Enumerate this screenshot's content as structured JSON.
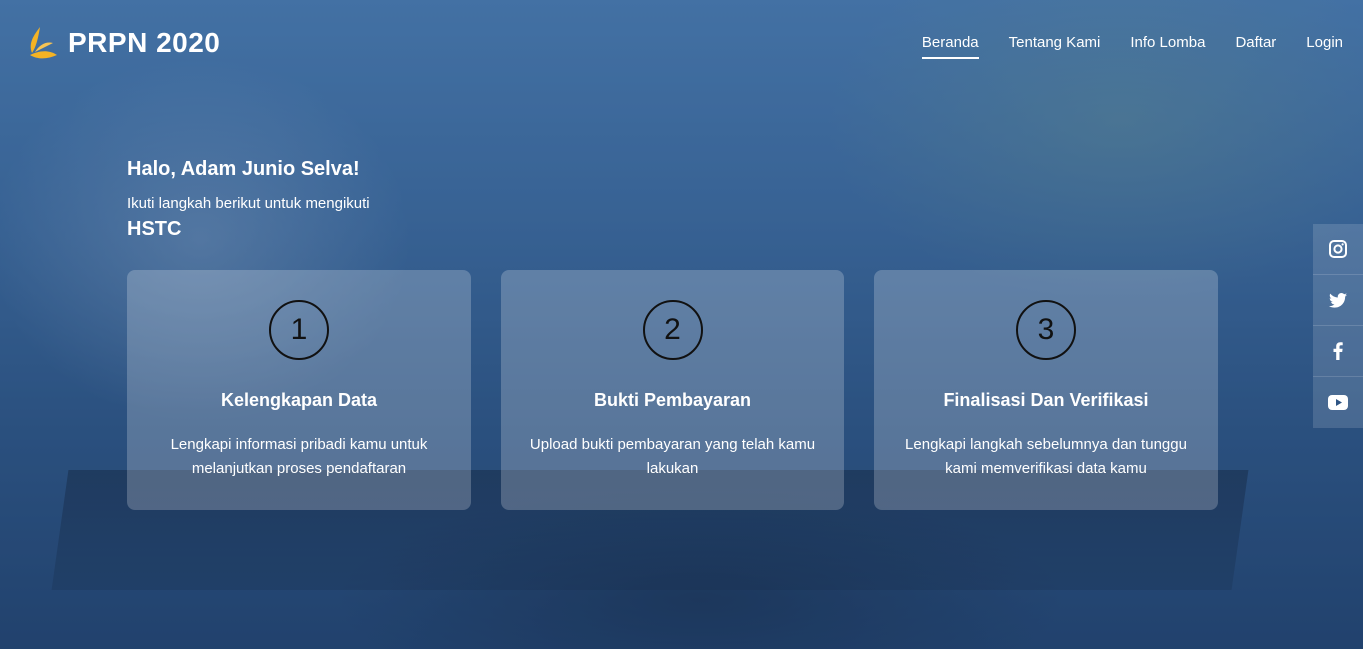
{
  "brand": {
    "name": "PRPN 2020",
    "logo_icon": "flame-leaf-icon",
    "logo_color": "#f5b324"
  },
  "nav": {
    "items": [
      {
        "label": "Beranda",
        "active": true
      },
      {
        "label": "Tentang Kami",
        "active": false
      },
      {
        "label": "Info Lomba",
        "active": false
      },
      {
        "label": "Daftar",
        "active": false
      },
      {
        "label": "Login",
        "active": false
      }
    ]
  },
  "intro": {
    "greeting": "Halo, Adam Junio Selva!",
    "subtitle": "Ikuti langkah berikut untuk mengikuti",
    "event": "HSTC"
  },
  "steps": [
    {
      "number": "1",
      "title": "Kelengkapan Data",
      "description": "Lengkapi informasi pribadi kamu untuk melanjutkan proses pendaftaran"
    },
    {
      "number": "2",
      "title": "Bukti Pembayaran",
      "description": "Upload bukti pembayaran yang telah kamu lakukan"
    },
    {
      "number": "3",
      "title": "Finalisasi Dan Verifikasi",
      "description": "Lengkapi langkah sebelumnya dan tunggu kami memverifikasi data kamu"
    }
  ],
  "social": [
    {
      "icon": "instagram-icon"
    },
    {
      "icon": "twitter-icon"
    },
    {
      "icon": "facebook-icon"
    },
    {
      "icon": "youtube-icon"
    }
  ]
}
